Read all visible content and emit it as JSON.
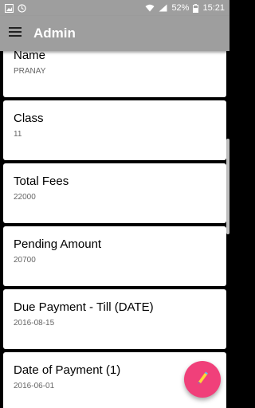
{
  "status_bar": {
    "battery": "52%",
    "time": "15:21",
    "icons": [
      "image-icon",
      "sync-icon",
      "wifi-icon",
      "signal-icon",
      "battery-icon"
    ]
  },
  "app_bar": {
    "title": "Admin",
    "menu_icon": "hamburger-menu-icon"
  },
  "fields": [
    {
      "label": "Name",
      "value": "PRANAY"
    },
    {
      "label": "Class",
      "value": "11"
    },
    {
      "label": "Total Fees",
      "value": "22000"
    },
    {
      "label": "Pending Amount",
      "value": "20700"
    },
    {
      "label": "Due Payment - Till (DATE)",
      "value": "2016-08-15"
    },
    {
      "label": "Date of Payment (1)",
      "value": "2016-06-01"
    }
  ],
  "fab": {
    "icon": "pen-icon",
    "color": "#f0407a"
  },
  "colors": {
    "app_bar": "#9e9e9e",
    "background": "#000000",
    "card": "#ffffff"
  }
}
